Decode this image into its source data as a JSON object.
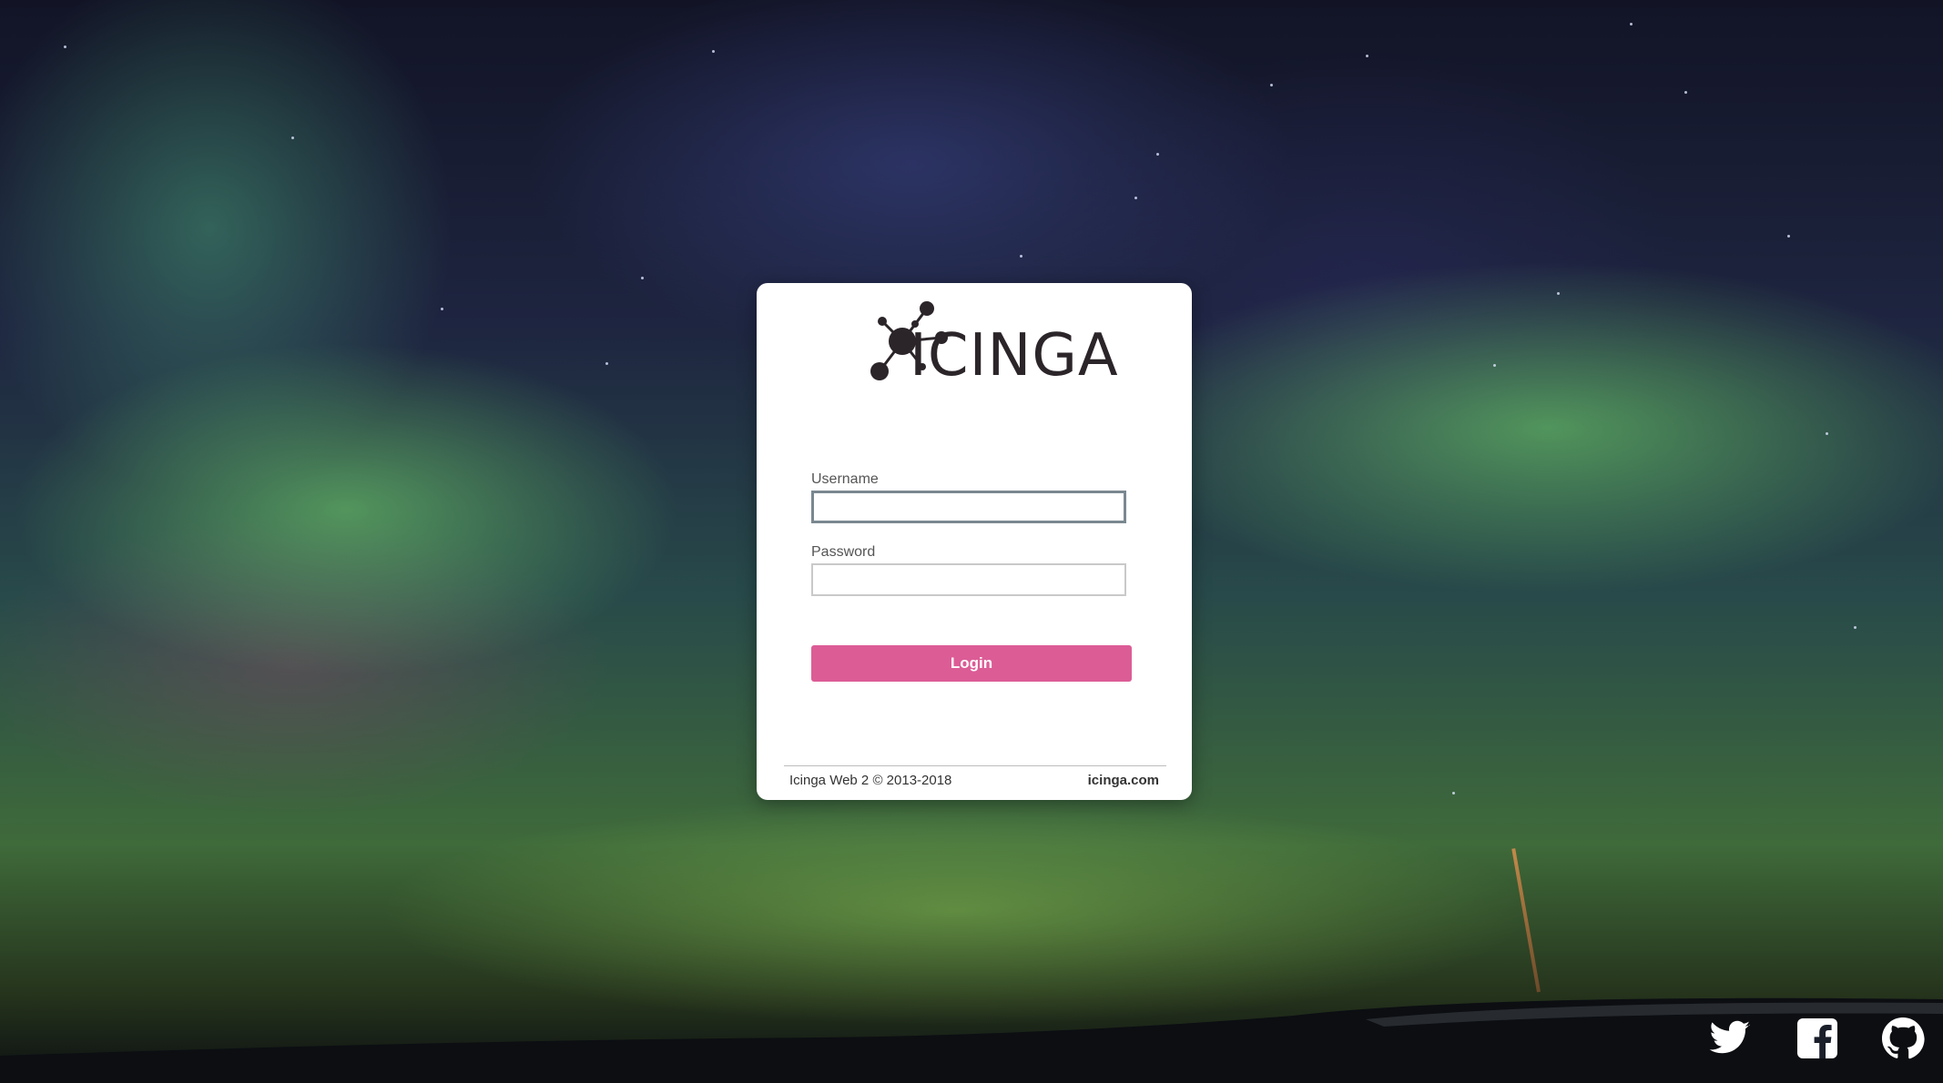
{
  "brand": {
    "name": "icinga",
    "wordmark": "ICINGA",
    "accent_color": "#dc5c96"
  },
  "form": {
    "username_label": "Username",
    "username_value": "",
    "password_label": "Password",
    "password_value": "",
    "login_label": "Login"
  },
  "footer": {
    "copyright": "Icinga Web 2 © 2013-2018",
    "site_link": "icinga.com"
  },
  "social": [
    {
      "name": "twitter",
      "icon": "twitter-icon"
    },
    {
      "name": "facebook",
      "icon": "facebook-icon"
    },
    {
      "name": "github",
      "icon": "github-icon"
    }
  ]
}
